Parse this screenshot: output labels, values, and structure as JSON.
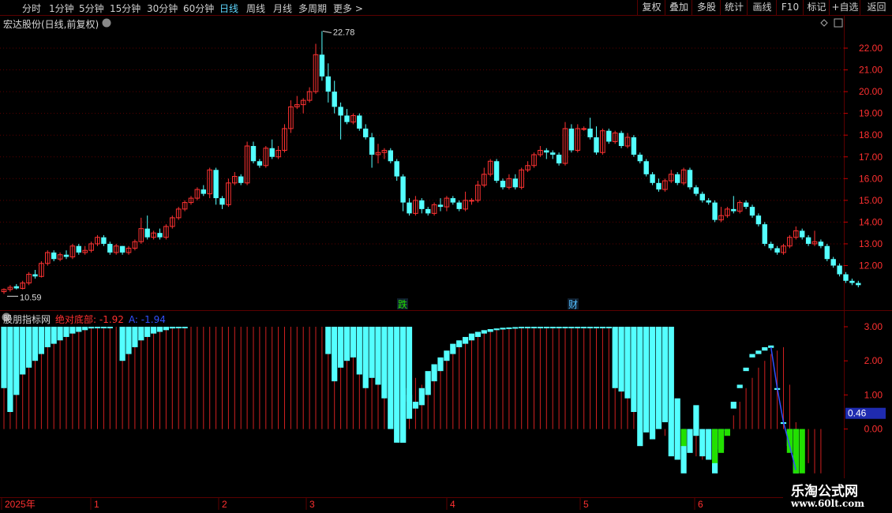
{
  "toolbar": {
    "periods": [
      "分时",
      "1分钟",
      "5分钟",
      "15分钟",
      "30分钟",
      "60分钟",
      "日线",
      "周线",
      "月线",
      "多周期"
    ],
    "active_period": "日线",
    "more_label": "更多 >",
    "right_buttons": [
      "复权",
      "叠加",
      "多股",
      "统计",
      "画线",
      "F10",
      "标记",
      "+自选",
      "返回"
    ]
  },
  "stock": {
    "title": "宏达股份(日线,前复权)",
    "high_label": "22.78",
    "low_label": "10.59"
  },
  "markers": [
    "跌",
    "财"
  ],
  "indicator": {
    "name": "股朋指标网",
    "line1_label": "绝对底部: -1.92",
    "line2_label": "A: -1.94",
    "current_value": "0.46"
  },
  "x_axis": {
    "labels": [
      "2025年",
      "1",
      "2",
      "3",
      "4",
      "5",
      "6"
    ]
  },
  "price_ticks": [
    "22.00",
    "21.00",
    "20.00",
    "19.00",
    "18.00",
    "17.00",
    "16.00",
    "15.00",
    "14.00",
    "13.00",
    "12.00"
  ],
  "ind_ticks": [
    "3.00",
    "2.00",
    "1.00",
    "0.00"
  ],
  "watermark": {
    "title": "乐淘公式网",
    "url": "www.60lt.com"
  },
  "colors": {
    "up": "#ff3232",
    "down": "#54ffff",
    "green": "#22e000",
    "grid": "#5a0000",
    "blue": "#3050ff"
  },
  "chart_data": {
    "type": "candlestick",
    "price_axis": {
      "min": 11.0,
      "max": 22.0
    },
    "candles": [
      [
        10.8,
        10.9,
        10.7,
        10.95
      ],
      [
        10.9,
        11.0,
        10.8,
        11.1
      ],
      [
        11.05,
        10.95,
        10.9,
        11.15
      ],
      [
        10.95,
        11.2,
        10.9,
        11.3
      ],
      [
        11.2,
        11.6,
        11.1,
        11.7
      ],
      [
        11.6,
        11.5,
        11.4,
        11.8
      ],
      [
        11.5,
        12.1,
        11.45,
        12.2
      ],
      [
        12.1,
        12.6,
        12.0,
        12.7
      ],
      [
        12.6,
        12.3,
        12.2,
        12.7
      ],
      [
        12.3,
        12.5,
        12.2,
        12.6
      ],
      [
        12.5,
        12.4,
        12.3,
        12.7
      ],
      [
        12.4,
        12.9,
        12.3,
        13.0
      ],
      [
        12.9,
        12.6,
        12.5,
        13.0
      ],
      [
        12.6,
        12.7,
        12.5,
        12.9
      ],
      [
        12.7,
        13.0,
        12.6,
        13.1
      ],
      [
        13.0,
        13.3,
        12.9,
        13.4
      ],
      [
        13.3,
        13.0,
        12.9,
        13.4
      ],
      [
        13.0,
        12.6,
        12.5,
        13.1
      ],
      [
        12.6,
        12.9,
        12.5,
        13.0
      ],
      [
        12.9,
        12.6,
        12.5,
        12.9
      ],
      [
        12.6,
        12.8,
        12.5,
        12.9
      ],
      [
        12.8,
        13.1,
        12.7,
        13.2
      ],
      [
        13.1,
        13.7,
        13.0,
        14.2
      ],
      [
        13.7,
        13.3,
        13.2,
        14.3
      ],
      [
        13.3,
        13.5,
        13.2,
        13.6
      ],
      [
        13.5,
        13.3,
        13.2,
        13.7
      ],
      [
        13.3,
        13.8,
        13.2,
        13.9
      ],
      [
        13.8,
        14.2,
        13.7,
        14.3
      ],
      [
        14.2,
        14.6,
        14.1,
        14.7
      ],
      [
        14.6,
        14.9,
        14.5,
        15.0
      ],
      [
        14.9,
        15.1,
        14.8,
        15.2
      ],
      [
        15.1,
        15.5,
        15.0,
        15.6
      ],
      [
        15.5,
        15.3,
        15.2,
        15.7
      ],
      [
        15.3,
        16.4,
        15.1,
        16.5
      ],
      [
        16.4,
        15.1,
        14.8,
        16.5
      ],
      [
        15.1,
        14.8,
        14.6,
        15.2
      ],
      [
        14.8,
        15.8,
        14.7,
        16.0
      ],
      [
        15.8,
        16.1,
        15.7,
        16.3
      ],
      [
        16.1,
        15.8,
        15.7,
        16.2
      ],
      [
        15.8,
        17.5,
        15.7,
        17.7
      ],
      [
        17.5,
        16.8,
        16.7,
        17.7
      ],
      [
        16.8,
        16.6,
        16.5,
        16.9
      ],
      [
        16.6,
        17.4,
        16.5,
        17.5
      ],
      [
        17.4,
        17.0,
        16.9,
        17.8
      ],
      [
        17.0,
        17.3,
        16.9,
        17.5
      ],
      [
        17.3,
        18.3,
        17.2,
        18.5
      ],
      [
        18.3,
        19.3,
        18.1,
        19.6
      ],
      [
        19.3,
        19.4,
        19.2,
        19.8
      ],
      [
        19.4,
        19.6,
        19.0,
        19.7
      ],
      [
        19.6,
        20.0,
        19.5,
        20.2
      ],
      [
        20.0,
        21.7,
        19.9,
        22.2
      ],
      [
        21.7,
        20.7,
        20.5,
        22.78
      ],
      [
        20.7,
        20.0,
        19.5,
        21.3
      ],
      [
        20.0,
        19.3,
        19.0,
        20.5
      ],
      [
        19.3,
        18.9,
        17.8,
        19.5
      ],
      [
        18.9,
        18.6,
        18.5,
        19.2
      ],
      [
        18.6,
        18.9,
        18.5,
        19.0
      ],
      [
        18.9,
        18.3,
        18.2,
        19.0
      ],
      [
        18.3,
        17.9,
        17.8,
        18.5
      ],
      [
        17.9,
        17.1,
        16.5,
        18.1
      ],
      [
        17.1,
        17.2,
        16.7,
        17.6
      ],
      [
        17.2,
        17.3,
        16.9,
        17.4
      ],
      [
        17.3,
        16.8,
        16.7,
        17.4
      ],
      [
        16.8,
        16.1,
        15.9,
        16.9
      ],
      [
        16.1,
        14.9,
        14.5,
        16.2
      ],
      [
        14.9,
        14.4,
        14.3,
        15.1
      ],
      [
        14.4,
        15.0,
        14.3,
        15.2
      ],
      [
        15.0,
        14.6,
        14.4,
        15.1
      ],
      [
        14.6,
        14.4,
        14.3,
        14.7
      ],
      [
        14.4,
        14.8,
        14.3,
        14.9
      ],
      [
        14.8,
        14.7,
        14.5,
        15.1
      ],
      [
        14.7,
        15.1,
        14.5,
        15.2
      ],
      [
        15.1,
        14.9,
        14.8,
        15.2
      ],
      [
        14.9,
        14.6,
        14.5,
        15.0
      ],
      [
        14.6,
        15.0,
        14.5,
        15.4
      ],
      [
        15.0,
        15.0,
        14.8,
        15.1
      ],
      [
        15.0,
        15.7,
        14.9,
        15.9
      ],
      [
        15.7,
        16.2,
        15.6,
        16.5
      ],
      [
        16.2,
        16.8,
        16.1,
        16.9
      ],
      [
        16.8,
        15.9,
        15.8,
        16.9
      ],
      [
        15.9,
        15.6,
        15.5,
        16.0
      ],
      [
        15.6,
        16.0,
        15.5,
        16.2
      ],
      [
        16.0,
        15.6,
        15.5,
        16.2
      ],
      [
        15.6,
        16.4,
        15.5,
        16.5
      ],
      [
        16.4,
        16.6,
        16.3,
        16.8
      ],
      [
        16.6,
        17.1,
        16.5,
        17.2
      ],
      [
        17.1,
        17.3,
        17.0,
        17.5
      ],
      [
        17.3,
        17.2,
        16.9,
        17.4
      ],
      [
        17.2,
        17.1,
        16.9,
        17.3
      ],
      [
        17.1,
        16.7,
        16.6,
        17.2
      ],
      [
        16.7,
        18.3,
        16.6,
        18.6
      ],
      [
        18.3,
        17.3,
        17.2,
        18.5
      ],
      [
        17.3,
        18.3,
        17.2,
        18.5
      ],
      [
        18.3,
        18.3,
        18.2,
        18.4
      ],
      [
        18.3,
        17.9,
        17.8,
        18.8
      ],
      [
        17.9,
        17.2,
        17.1,
        18.4
      ],
      [
        17.2,
        18.2,
        17.1,
        18.3
      ],
      [
        18.2,
        17.7,
        17.6,
        18.3
      ],
      [
        17.7,
        18.1,
        17.6,
        18.2
      ],
      [
        18.1,
        17.5,
        17.4,
        18.2
      ],
      [
        17.5,
        17.9,
        17.4,
        18.1
      ],
      [
        17.9,
        17.1,
        17.0,
        18.0
      ],
      [
        17.1,
        16.8,
        16.7,
        17.2
      ],
      [
        16.8,
        16.2,
        16.1,
        16.9
      ],
      [
        16.2,
        15.8,
        15.7,
        16.3
      ],
      [
        15.8,
        15.5,
        15.4,
        16.0
      ],
      [
        15.5,
        15.9,
        15.4,
        16.0
      ],
      [
        15.9,
        16.2,
        15.8,
        16.4
      ],
      [
        16.2,
        15.8,
        15.7,
        16.3
      ],
      [
        15.8,
        16.4,
        15.7,
        16.5
      ],
      [
        16.4,
        15.6,
        15.5,
        16.5
      ],
      [
        15.6,
        15.3,
        15.2,
        15.7
      ],
      [
        15.3,
        15.0,
        14.9,
        15.4
      ],
      [
        15.0,
        14.9,
        14.8,
        15.1
      ],
      [
        14.9,
        14.1,
        14.0,
        15.0
      ],
      [
        14.1,
        14.3,
        14.0,
        14.7
      ],
      [
        14.3,
        14.6,
        14.2,
        14.7
      ],
      [
        14.6,
        14.5,
        14.4,
        15.2
      ],
      [
        14.5,
        14.9,
        14.4,
        15.0
      ],
      [
        14.9,
        14.7,
        14.6,
        15.0
      ],
      [
        14.7,
        14.3,
        14.2,
        14.8
      ],
      [
        14.3,
        13.9,
        13.8,
        14.4
      ],
      [
        13.9,
        13.0,
        12.9,
        14.0
      ],
      [
        13.0,
        12.8,
        12.7,
        13.1
      ],
      [
        12.8,
        12.6,
        12.5,
        12.9
      ],
      [
        12.6,
        12.9,
        12.5,
        13.0
      ],
      [
        12.9,
        13.3,
        12.8,
        13.4
      ],
      [
        13.3,
        13.6,
        13.2,
        13.8
      ],
      [
        13.6,
        13.3,
        13.2,
        13.7
      ],
      [
        13.3,
        13.0,
        12.9,
        13.4
      ],
      [
        13.0,
        13.1,
        12.9,
        13.6
      ],
      [
        13.1,
        12.9,
        12.8,
        13.2
      ],
      [
        12.9,
        12.3,
        12.2,
        13.0
      ],
      [
        12.3,
        12.0,
        11.9,
        12.4
      ],
      [
        12.0,
        11.6,
        11.5,
        12.1
      ],
      [
        11.6,
        11.3,
        11.2,
        11.7
      ],
      [
        11.3,
        11.2,
        11.1,
        11.4
      ],
      [
        11.2,
        11.1,
        11.0,
        11.3
      ]
    ],
    "indicator_axis": {
      "min": -1.3,
      "max": 3.0
    },
    "indicator_red_lines": [
      2.0,
      2.4,
      2.6,
      2.7,
      2.8,
      2.85,
      2.9,
      2.95,
      2.97,
      2.98,
      2.99,
      3.0,
      3.0,
      3.0,
      3.0,
      3.0,
      3.0,
      3.0,
      3.0,
      3.0,
      3.0,
      3.0,
      3.0,
      3.0,
      3.0,
      3.0,
      3.0,
      3.0,
      3.0,
      3.0,
      3.0,
      3.0,
      3.0,
      3.0,
      3.0,
      3.0,
      3.0,
      3.0,
      3.0,
      3.0,
      3.0,
      3.0,
      3.0,
      3.0,
      3.0,
      3.0,
      3.0,
      3.0,
      3.0,
      3.0,
      3.0,
      3.0,
      3.0,
      3.0,
      3.0,
      3.0,
      3.0,
      3.0,
      3.0,
      3.0,
      3.0,
      3.0,
      3.0,
      2.8,
      2.4,
      1.9,
      1.5,
      1.3,
      1.5,
      1.9,
      2.1,
      2.3,
      2.5,
      2.6,
      2.7,
      2.8,
      2.85,
      2.9,
      2.93,
      2.95,
      2.97,
      2.98,
      2.99,
      3.0,
      3.0,
      3.0,
      3.0,
      3.0,
      3.0,
      3.0,
      3.0,
      3.0,
      3.0,
      3.0,
      3.0,
      3.0,
      3.0,
      3.0,
      3.0,
      3.0,
      3.0,
      2.0,
      1.7,
      1.1,
      0.6,
      0.0,
      -0.2,
      -0.3,
      -0.4,
      -0.5,
      -0.6,
      -0.8,
      -0.9,
      -0.7,
      -0.5,
      -0.3,
      0.0,
      0.4,
      0.8,
      1.2,
      1.5,
      1.8,
      2.0,
      2.2,
      2.3,
      2.4,
      1.3,
      0.2,
      -0.6,
      -1.0,
      -1.3,
      -1.3
    ],
    "indicator_bars": [
      [
        0,
        3.0,
        1.2
      ],
      [
        1,
        3.0,
        0.5
      ],
      [
        2,
        3.0,
        1.0
      ],
      [
        3,
        3.0,
        1.6
      ],
      [
        4,
        3.0,
        1.8
      ],
      [
        5,
        3.0,
        2.0
      ],
      [
        6,
        3.0,
        2.2
      ],
      [
        7,
        3.0,
        2.4
      ],
      [
        8,
        3.0,
        2.5
      ],
      [
        9,
        3.0,
        2.6
      ],
      [
        10,
        3.0,
        2.7
      ],
      [
        11,
        3.0,
        2.8
      ],
      [
        12,
        3.0,
        2.85
      ],
      [
        13,
        3.0,
        2.9
      ],
      [
        14,
        3.0,
        2.95
      ],
      [
        15,
        3.0,
        2.98
      ],
      [
        16,
        3.0,
        2.99
      ],
      [
        17,
        3.0,
        3.0
      ],
      [
        19,
        3.0,
        2.0
      ],
      [
        20,
        3.0,
        2.2
      ],
      [
        21,
        3.0,
        2.4
      ],
      [
        22,
        3.0,
        2.6
      ],
      [
        23,
        3.0,
        2.7
      ],
      [
        24,
        3.0,
        2.8
      ],
      [
        25,
        3.0,
        2.85
      ],
      [
        26,
        3.0,
        2.9
      ],
      [
        27,
        3.0,
        2.95
      ],
      [
        28,
        3.0,
        2.98
      ],
      [
        29,
        3.0,
        3.0
      ],
      [
        52,
        3.0,
        2.2
      ],
      [
        53,
        3.0,
        1.4
      ],
      [
        54,
        3.0,
        1.8
      ],
      [
        55,
        3.0,
        2.0
      ],
      [
        56,
        3.0,
        2.1
      ],
      [
        57,
        3.0,
        1.6
      ],
      [
        58,
        3.0,
        1.2
      ],
      [
        59,
        3.0,
        1.5
      ],
      [
        60,
        3.0,
        1.3
      ],
      [
        61,
        3.0,
        0.9
      ],
      [
        62,
        3.0,
        0.0
      ],
      [
        63,
        3.0,
        -0.4
      ],
      [
        64,
        3.0,
        -0.4
      ],
      [
        65,
        3.0,
        0.8
      ],
      [
        64,
        1.2,
        -0.4
      ],
      [
        65,
        1.0,
        0.3
      ],
      [
        66,
        0.8,
        0.6
      ],
      [
        67,
        1.2,
        0.7
      ],
      [
        68,
        1.7,
        1.0
      ],
      [
        69,
        1.9,
        1.4
      ],
      [
        70,
        2.1,
        1.7
      ],
      [
        71,
        2.3,
        2.0
      ],
      [
        72,
        2.5,
        2.2
      ],
      [
        73,
        2.6,
        2.4
      ],
      [
        74,
        2.7,
        2.5
      ],
      [
        75,
        2.8,
        2.6
      ],
      [
        76,
        2.85,
        2.7
      ],
      [
        77,
        2.9,
        2.8
      ],
      [
        78,
        2.93,
        2.85
      ],
      [
        79,
        2.95,
        2.9
      ],
      [
        80,
        2.97,
        2.92
      ],
      [
        81,
        2.98,
        2.95
      ],
      [
        82,
        2.99,
        2.96
      ],
      [
        83,
        3.0,
        2.97
      ],
      [
        84,
        3.0,
        2.97
      ],
      [
        85,
        3.0,
        2.98
      ],
      [
        86,
        3.0,
        2.98
      ],
      [
        87,
        3.0,
        2.98
      ],
      [
        88,
        3.0,
        2.99
      ],
      [
        89,
        3.0,
        2.99
      ],
      [
        90,
        3.0,
        2.99
      ],
      [
        91,
        3.0,
        2.99
      ],
      [
        92,
        3.0,
        2.99
      ],
      [
        93,
        3.0,
        3.0
      ],
      [
        94,
        3.0,
        3.0
      ],
      [
        95,
        3.0,
        3.0
      ],
      [
        96,
        3.0,
        3.0
      ],
      [
        97,
        3.0,
        3.0
      ],
      [
        98,
        3.0,
        1.2
      ],
      [
        99,
        3.0,
        1.1
      ],
      [
        100,
        3.0,
        0.9
      ],
      [
        101,
        3.0,
        0.5
      ],
      [
        102,
        3.0,
        -0.5
      ],
      [
        103,
        3.0,
        -0.1
      ],
      [
        104,
        3.0,
        -0.3
      ],
      [
        105,
        3.0,
        0.0
      ],
      [
        106,
        3.0,
        0.2
      ],
      [
        107,
        3.0,
        -0.8
      ],
      [
        108,
        0.9,
        -0.9
      ],
      [
        109,
        0.0,
        -1.3
      ],
      [
        110,
        0.0,
        -0.7
      ],
      [
        111,
        0.7,
        -0.2
      ],
      [
        112,
        0.0,
        -0.8
      ],
      [
        113,
        0.0,
        -0.9
      ],
      [
        114,
        0.0,
        -1.3
      ],
      [
        115,
        0.0,
        -0.6
      ],
      [
        116,
        0.0,
        0.0
      ],
      [
        117,
        0.8,
        0.6
      ],
      [
        118,
        1.3,
        1.2
      ],
      [
        119,
        1.8,
        1.7
      ],
      [
        120,
        2.2,
        2.1
      ],
      [
        121,
        2.3,
        2.2
      ],
      [
        122,
        2.4,
        2.3
      ],
      [
        123,
        2.45,
        2.38
      ],
      [
        124,
        1.2,
        1.15
      ],
      [
        125,
        0.2,
        0.15
      ],
      [
        126,
        0.0,
        -0.5
      ],
      [
        127,
        0.0,
        -1.3
      ]
    ],
    "indicator_green": [
      [
        109,
        0.0,
        -0.5
      ],
      [
        114,
        0.0,
        -1.0
      ],
      [
        115,
        0.0,
        -0.7
      ],
      [
        116,
        0.0,
        -0.2
      ],
      [
        126,
        0.0,
        -0.7
      ],
      [
        127,
        0.0,
        -1.3
      ],
      [
        128,
        0.0,
        -1.3
      ]
    ],
    "blue_line": [
      [
        123,
        2.4
      ],
      [
        124,
        1.2
      ],
      [
        125,
        0.2
      ],
      [
        126,
        -0.5
      ],
      [
        127,
        -1.2
      ]
    ]
  }
}
